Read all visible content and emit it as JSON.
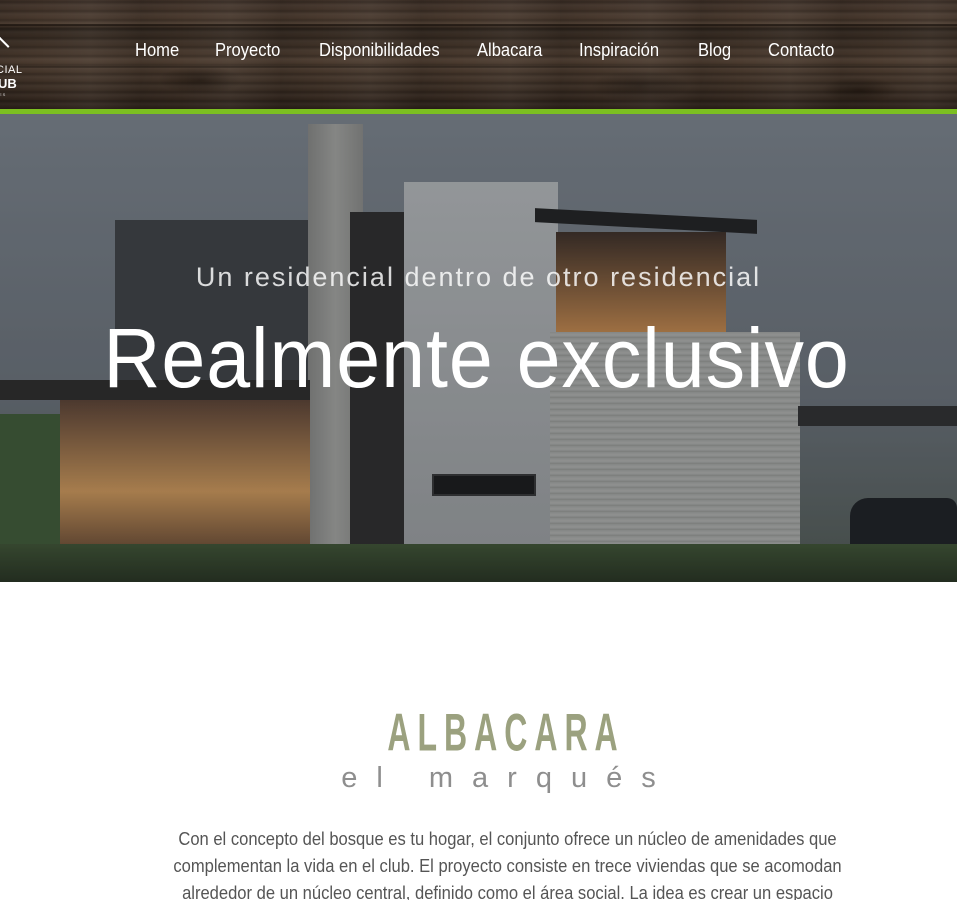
{
  "logo": {
    "line1": "CIAL",
    "line2": "UB",
    "line3": "ES"
  },
  "nav": {
    "items": [
      {
        "label": "Home"
      },
      {
        "label": "Proyecto"
      },
      {
        "label": "Disponibilidades"
      },
      {
        "label": "Albacara"
      },
      {
        "label": "Inspiración"
      },
      {
        "label": "Blog"
      },
      {
        "label": "Contacto"
      }
    ]
  },
  "hero": {
    "subtitle": "Un residencial dentro de otro residencial",
    "title": "Realmente exclusivo"
  },
  "brand": {
    "name": "ALBACARA",
    "subtitle": "el marqués"
  },
  "intro": {
    "text": "Con el concepto del bosque es tu hogar, el conjunto ofrece un núcleo de amenidades que complementan la vida en el club. El proyecto consiste en trece viviendas que se acomodan alrededor de un núcleo central, definido como el área social. La idea es crear un espacio acogedor,"
  },
  "colors": {
    "accent_green": "#7cbf21",
    "brand_olive": "#9ba17f",
    "text_gray": "#555555"
  }
}
